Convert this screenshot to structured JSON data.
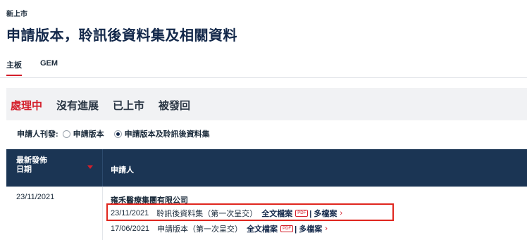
{
  "breadcrumb": "新上市",
  "page_title": "申請版本，聆訊後資料集及相關資料",
  "board_tabs": [
    {
      "label": "主板",
      "active": true
    },
    {
      "label": "GEM",
      "active": false
    }
  ],
  "status_tabs": [
    {
      "label": "處理中",
      "active": true
    },
    {
      "label": "沒有進展",
      "active": false
    },
    {
      "label": "已上市",
      "active": false
    },
    {
      "label": "被發回",
      "active": false
    }
  ],
  "filter": {
    "label": "申請人刊發:",
    "options": [
      {
        "label": "申請版本",
        "selected": false
      },
      {
        "label": "申請版本及聆訊後資料集",
        "selected": true
      }
    ]
  },
  "table": {
    "headers": {
      "date_line1": "最新發佈",
      "date_line2": "日期",
      "applicant": "申請人"
    },
    "rows": [
      {
        "date": "23/11/2021",
        "company": "雍禾醫療集團有限公司",
        "documents": [
          {
            "date": "23/11/2021",
            "title": "聆訊後資料集（第一次呈交）",
            "full_doc": "全文檔案",
            "pdf": "PDF",
            "multi": "| 多檔案",
            "chevron": "›"
          },
          {
            "date": "17/06/2021",
            "title": "申請版本（第一次呈交）",
            "full_doc": "全文檔案",
            "pdf": "PDF",
            "multi": "| 多檔案",
            "chevron": "›"
          }
        ]
      }
    ]
  },
  "colors": {
    "accent_red": "#d41f2b",
    "header_navy": "#1b3554",
    "highlight_box": "#e0261e"
  }
}
